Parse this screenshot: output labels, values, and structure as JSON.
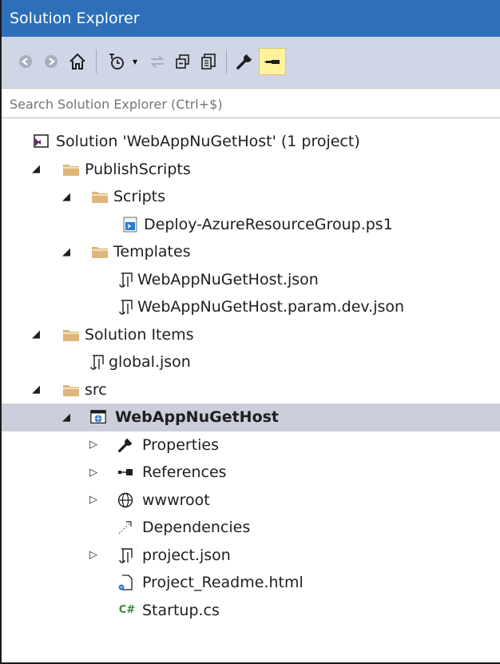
{
  "window": {
    "title": "Solution Explorer"
  },
  "toolbar": {
    "buttons": [
      "back-icon",
      "forward-icon",
      "home-icon",
      "history-icon",
      "dropdown-icon",
      "sync-icon",
      "collapse-icon",
      "show-all-files-icon",
      "properties-icon",
      "pin-icon"
    ]
  },
  "search": {
    "placeholder": "Search Solution Explorer (Ctrl+$)"
  },
  "tree": {
    "items": [
      {
        "label": "Solution 'WebAppNuGetHost' (1 project)"
      },
      {
        "label": "PublishScripts"
      },
      {
        "label": "Scripts"
      },
      {
        "label": "Deploy-AzureResourceGroup.ps1"
      },
      {
        "label": "Templates"
      },
      {
        "label": "WebAppNuGetHost.json"
      },
      {
        "label": "WebAppNuGetHost.param.dev.json"
      },
      {
        "label": "Solution Items"
      },
      {
        "label": "global.json"
      },
      {
        "label": "src"
      },
      {
        "label": "WebAppNuGetHost"
      },
      {
        "label": "Properties"
      },
      {
        "label": "References"
      },
      {
        "label": "wwwroot"
      },
      {
        "label": "Dependencies"
      },
      {
        "label": "project.json"
      },
      {
        "label": "Project_Readme.html"
      },
      {
        "label": "Startup.cs"
      }
    ]
  },
  "colors": {
    "title_bar": "#2d6fb8",
    "toolbar": "#cfd6e5",
    "selected_row": "#cccedb",
    "folder": "#dcb67a",
    "pin_highlight": "#fff29d"
  }
}
